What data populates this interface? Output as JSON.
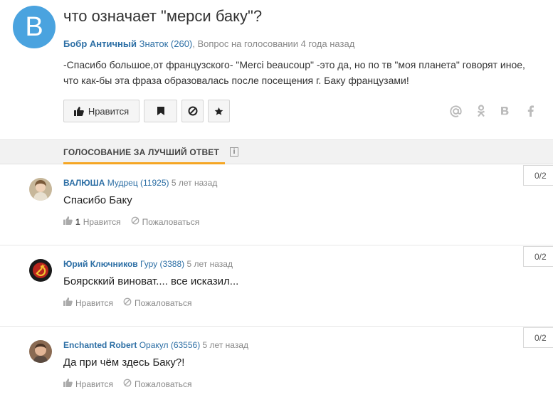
{
  "question": {
    "avatar_letter": "B",
    "title": "что означает \"мерси баку\"?",
    "author": "Бобр Античный",
    "rank": "Знаток (260)",
    "status": ", Вопрос на голосовании 4 года назад",
    "text": "-Спасибо большое,от французского- \"Merci beaucoup\" -это да, но по тв \"моя планета\" говорят иное, что как-бы эта фраза образовалась после посещения г. Баку французами!",
    "like_label": "Нравится"
  },
  "share_icons": [
    "mail-icon",
    "odnoklassniki-icon",
    "vk-icon",
    "facebook-icon"
  ],
  "vote": {
    "title": "ГОЛОСОВАНИЕ ЗА ЛУЧШИЙ ОТВЕТ",
    "info_glyph": "i"
  },
  "answers": [
    {
      "author": "ВАЛЮША",
      "rank": "Мудрец (11925)",
      "time": "5 лет назад",
      "text": "Спасибо Баку",
      "likes": "1",
      "like_label": "Нравится",
      "report_label": "Пожаловаться",
      "score": "0/2"
    },
    {
      "author": "Юрий Ключников",
      "rank": "Гуру (3388)",
      "time": "5 лет назад",
      "text": "Боярсккий виноват.... все исказил...",
      "likes": "",
      "like_label": "Нравится",
      "report_label": "Пожаловаться",
      "score": "0/2"
    },
    {
      "author": "Enchanted Robert",
      "rank": "Оракул (63556)",
      "time": "5 лет назад",
      "text": "Да при чём здесь Баку?!",
      "likes": "",
      "like_label": "Нравится",
      "report_label": "Пожаловаться",
      "score": "0/2"
    }
  ],
  "colors": {
    "link": "#2d6fa5",
    "accent": "#f5a623",
    "avatar_bg": "#4aa3df"
  }
}
